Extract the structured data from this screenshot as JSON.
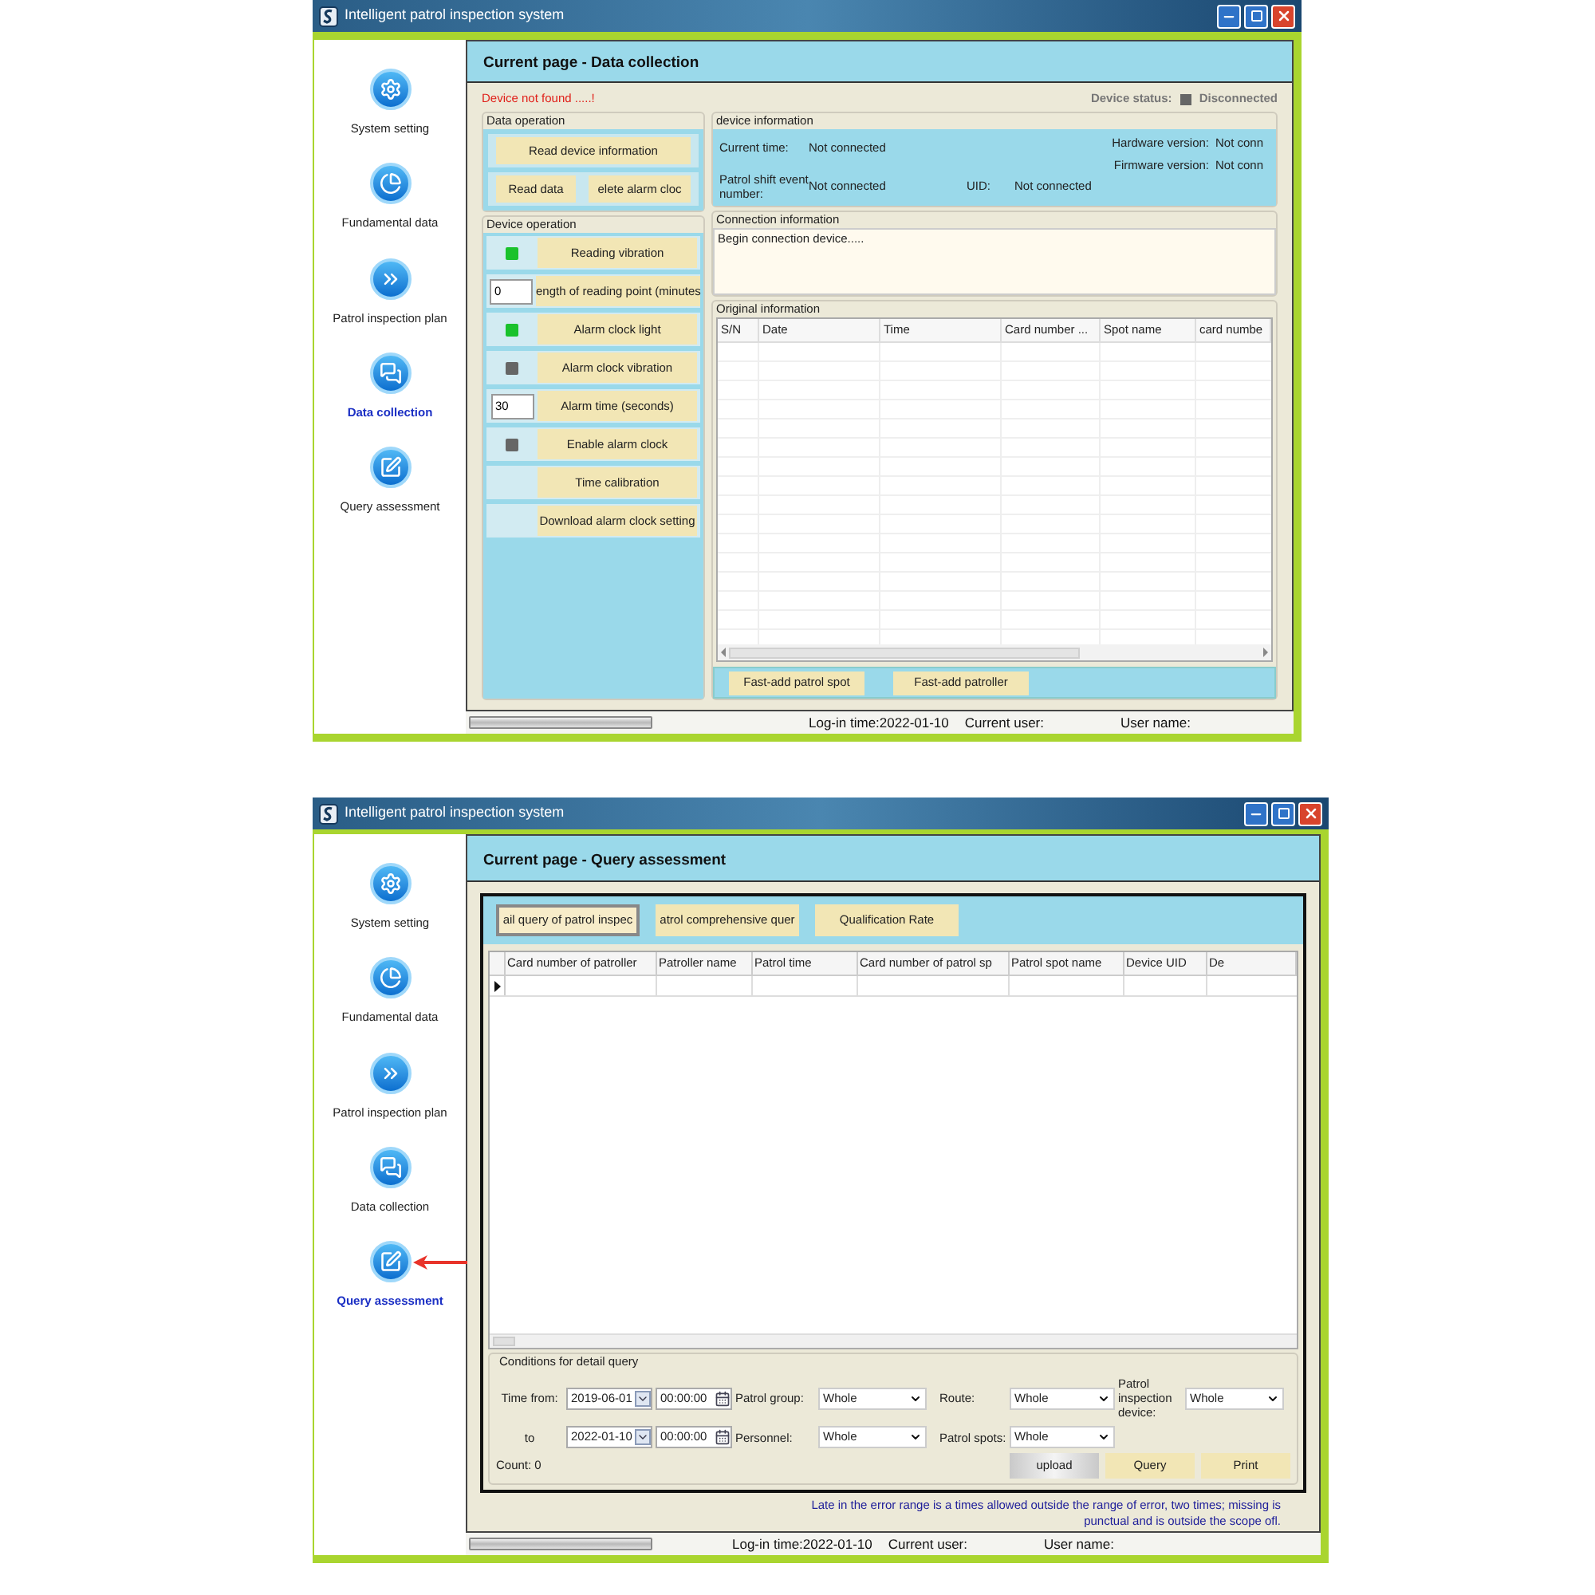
{
  "data_collection_window": {
    "title": "Intelligent patrol inspection system",
    "sidebar": {
      "items": [
        {
          "label": "System setting",
          "selected": false
        },
        {
          "label": "Fundamental data",
          "selected": false
        },
        {
          "label": "Patrol inspection plan",
          "selected": false
        },
        {
          "label": "Data collection",
          "selected": true
        },
        {
          "label": "Query assessment",
          "selected": false
        }
      ]
    },
    "page_title": "Current page - Data collection",
    "error_message": "Device not found .....!",
    "device_status": {
      "label": "Device status:",
      "connected": false,
      "text": "Disconnected"
    },
    "data_operation": {
      "title": "Data operation",
      "buttons": [
        "Read device information",
        "Read data",
        "elete alarm cloc"
      ]
    },
    "device_operation": {
      "title": "Device operation",
      "rows": [
        {
          "kind": "indicator",
          "on": true,
          "button": "Reading vibration"
        },
        {
          "kind": "input",
          "value": "0",
          "button": "ength of reading point (minutes"
        },
        {
          "kind": "indicator",
          "on": true,
          "button": "Alarm clock light"
        },
        {
          "kind": "indicator",
          "on": false,
          "button": "Alarm clock vibration"
        },
        {
          "kind": "input",
          "value": "30",
          "button": "Alarm time (seconds)"
        },
        {
          "kind": "indicator",
          "on": false,
          "button": "Enable alarm clock"
        },
        {
          "kind": "plain",
          "button": "Time calibration"
        },
        {
          "kind": "plain",
          "button": "Download alarm clock setting"
        }
      ]
    },
    "device_information": {
      "title": "device information",
      "fields": [
        {
          "label": "Current time:",
          "value": "Not connected"
        },
        {
          "label": "Hardware version:",
          "value": "Not conn"
        },
        {
          "label": "Firmware version:",
          "value": "Not conn"
        },
        {
          "label": "Patrol shift event number:",
          "value": "Not connected"
        },
        {
          "label": "UID:",
          "value": "Not connected"
        }
      ]
    },
    "connection_information": {
      "title": "Connection information",
      "text": "Begin connection device....."
    },
    "original_information": {
      "title": "Original information",
      "columns": [
        "S/N",
        "Date",
        "Time",
        "Card number ...",
        "Spot name",
        "card numbe"
      ]
    },
    "actions": [
      "Fast-add patrol spot",
      "Fast-add patroller"
    ],
    "status_bar": {
      "login_time": "Log-in time:2022-01-10",
      "current_user": "Current user:",
      "user_name": "User name:"
    }
  },
  "query_assessment_window": {
    "title": "Intelligent patrol inspection system",
    "sidebar": {
      "items": [
        {
          "label": "System setting",
          "selected": false
        },
        {
          "label": "Fundamental data",
          "selected": false
        },
        {
          "label": "Patrol inspection plan",
          "selected": false
        },
        {
          "label": "Data collection",
          "selected": false
        },
        {
          "label": "Query assessment",
          "selected": true
        }
      ]
    },
    "page_title": "Current page - Query assessment",
    "tabs": [
      {
        "label": "ail query of patrol inspec",
        "selected": true
      },
      {
        "label": "atrol comprehensive quer",
        "selected": false
      },
      {
        "label": "Qualification Rate",
        "selected": false
      }
    ],
    "table": {
      "columns": [
        "Card number of patroller",
        "Patroller name",
        "Patrol time",
        "Card number of patrol sp",
        "Patrol spot name",
        "Device UID",
        "De"
      ]
    },
    "conditions": {
      "title": "Conditions for detail query",
      "time_from": {
        "label": "Time from:",
        "date": "2019-06-01",
        "time": "00:00:00"
      },
      "time_to": {
        "label": "to",
        "date": "2022-01-10",
        "time": "00:00:00"
      },
      "filters": [
        {
          "label": "Patrol group:",
          "value": "Whole"
        },
        {
          "label": "Route:",
          "value": "Whole"
        },
        {
          "label": "Patrol inspection device:",
          "value": "Whole"
        },
        {
          "label": "Personnel:",
          "value": "Whole"
        },
        {
          "label": "Patrol spots:",
          "value": "Whole"
        }
      ],
      "count": "Count: 0",
      "buttons": [
        {
          "label": "upload",
          "kind": "secondary"
        },
        {
          "label": "Query",
          "kind": "primary"
        },
        {
          "label": "Print",
          "kind": "primary"
        }
      ]
    },
    "note": "Late in the error range is a times allowed outside the range of error, two times; missing is punctual and is outside the scope ofl.",
    "status_bar": {
      "login_time": "Log-in time:2022-01-10",
      "current_user": "Current user:",
      "user_name": "User name:"
    }
  }
}
